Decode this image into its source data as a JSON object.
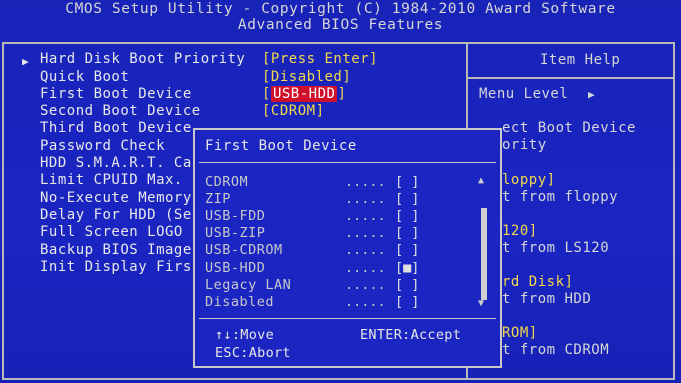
{
  "header": {
    "line1": "CMOS Setup Utility - Copyright (C) 1984-2010 Award Software",
    "line2": "Advanced BIOS Features"
  },
  "settings": [
    {
      "label": "Hard Disk Boot Priority",
      "value": "[Press Enter]",
      "submenu": true
    },
    {
      "label": "Quick Boot",
      "value": "[Disabled]"
    },
    {
      "label": "First Boot Device",
      "value": "[USB-HDD]",
      "selected": true
    },
    {
      "label": "Second Boot Device",
      "value": "[CDROM]"
    },
    {
      "label": "Third Boot Device",
      "value": ""
    },
    {
      "label": "Password Check",
      "value": ""
    },
    {
      "label": "HDD S.M.A.R.T. Ca",
      "value": ""
    },
    {
      "label": "Limit CPUID Max.",
      "value": ""
    },
    {
      "label": "No-Execute Memory",
      "value": ""
    },
    {
      "label": "Delay For HDD (Se",
      "value": ""
    },
    {
      "label": "Full Screen LOGO",
      "value": ""
    },
    {
      "label": "Backup BIOS Image",
      "value": ""
    },
    {
      "label": "Init Display Firs",
      "value": ""
    }
  ],
  "item_help": {
    "title": "Item Help",
    "menu_level": "Menu Level",
    "menu_level_arrow": "▶",
    "lines": [
      {
        "text": "ect Boot Device",
        "style": "normal"
      },
      {
        "text": "ority",
        "style": "normal"
      },
      {
        "text": "loppy]",
        "style": "yellow"
      },
      {
        "text": "t from floppy",
        "style": "normal"
      },
      {
        "text": "120]",
        "style": "yellow"
      },
      {
        "text": "t from LS120",
        "style": "normal"
      },
      {
        "text": "rd Disk]",
        "style": "yellow"
      },
      {
        "text": "t from HDD",
        "style": "normal"
      },
      {
        "text": "ROM]",
        "style": "yellow"
      },
      {
        "text": "t from CDROM",
        "style": "normal"
      }
    ]
  },
  "popup": {
    "title": "First Boot Device",
    "options": [
      {
        "label": "CDROM",
        "dots": ".....",
        "mark": "[ ]"
      },
      {
        "label": "ZIP",
        "dots": ".....",
        "mark": "[ ]"
      },
      {
        "label": "USB-FDD",
        "dots": ".....",
        "mark": "[ ]"
      },
      {
        "label": "USB-ZIP",
        "dots": ".....",
        "mark": "[ ]"
      },
      {
        "label": "USB-CDROM",
        "dots": ".....",
        "mark": "[ ]"
      },
      {
        "label": "USB-HDD",
        "dots": ".....",
        "mark": "[■]"
      },
      {
        "label": "Legacy LAN",
        "dots": ".....",
        "mark": "[ ]"
      },
      {
        "label": "Disabled",
        "dots": ".....",
        "mark": "[ ]"
      }
    ],
    "footer": {
      "move": "↑↓:Move",
      "accept": "ENTER:Accept",
      "abort": "ESC:Abort"
    }
  },
  "colors": {
    "background": "#1a25c2",
    "text": "#e8e8e8",
    "value": "#f2d84a",
    "highlight": "#d0102a"
  }
}
